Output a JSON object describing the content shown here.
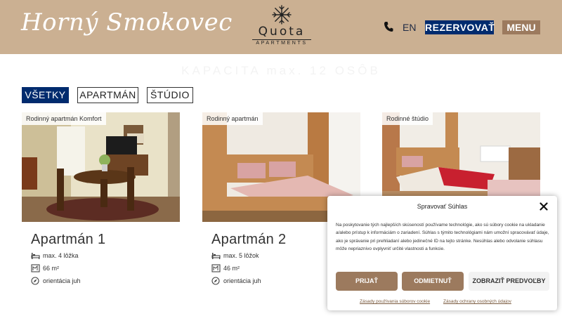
{
  "header": {
    "brand_script": "Horný Smokovec",
    "logo_name": "Quota",
    "logo_sub": "APARTMENTS",
    "lang": "EN",
    "reserve_label": "REZERVOVAŤ",
    "menu_label": "MENU"
  },
  "capacity_heading": "KAPACITA max. 12 OSÔB",
  "filters": [
    {
      "label": "VŠETKY",
      "active": true
    },
    {
      "label": "APARTMÁN",
      "active": false
    },
    {
      "label": "ŠTÚDIO",
      "active": false
    }
  ],
  "cards": [
    {
      "tag": "Rodinný apartmán Komfort",
      "title": "Apartmán 1",
      "beds": "max. 4 lôžka",
      "area": "66 m²",
      "orientation": "orientácia juh"
    },
    {
      "tag": "Rodinný apartmán",
      "title": "Apartmán 2",
      "beds": "max. 5 lôžok",
      "area": "46 m²",
      "orientation": "orientácia juh"
    },
    {
      "tag": "Rodinné štúdio"
    }
  ],
  "cookie": {
    "title": "Spravovať Súhlas",
    "text": "Na poskytovanie tých najlepších skúseností používame technológie, ako sú súbory cookie na ukladanie a/alebo prístup k informáciám o zariadení. Súhlas s týmito technológiami nám umožní spracovávať údaje, ako je správanie pri prehliadaní alebo jedinečné ID na tejto stránke. Nesúhlas alebo odvolanie súhlasu môže nepriaznivo ovplyvniť určité vlastnosti a funkcie.",
    "accept_label": "PRIJAŤ",
    "deny_label": "ODMIETNUŤ",
    "prefs_label": "ZOBRAZIŤ PREDVOĽBY",
    "link_cookies": "Zásady používania súborov cookie",
    "link_privacy": "Zásady ochrany osobných údajov"
  },
  "colors": {
    "header_bg": "#cbb092",
    "primary_blue": "#002b6e",
    "brown_accent": "#9c7a5e"
  },
  "icons": [
    "phone-icon",
    "bed-icon",
    "area-icon",
    "compass-icon",
    "close-icon"
  ]
}
